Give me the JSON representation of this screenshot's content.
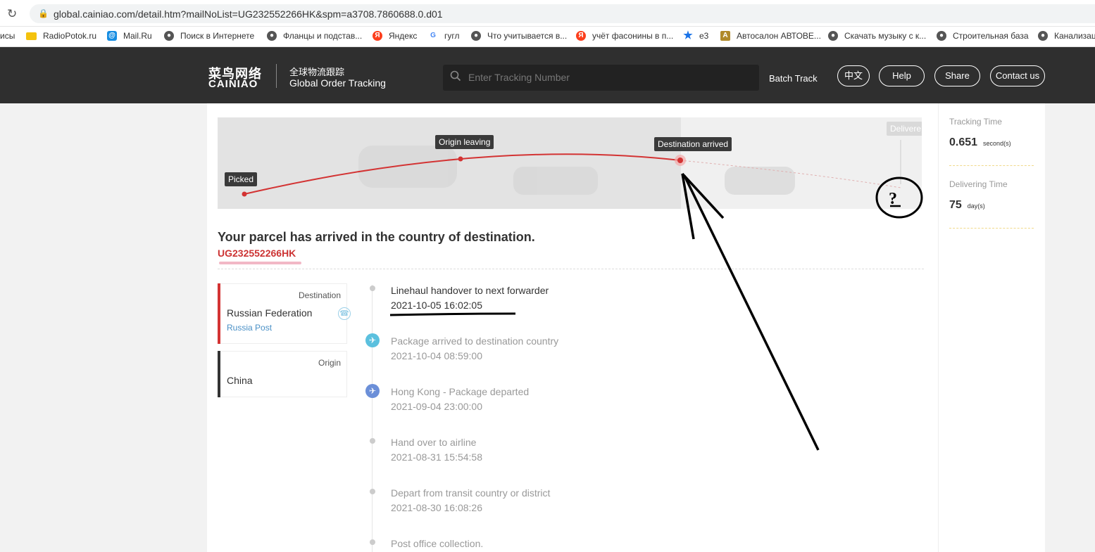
{
  "browser": {
    "url": "global.cainiao.com/detail.htm?mailNoList=UG232552266HK&spm=a3708.7860688.0.d01",
    "bookmarks": [
      {
        "label": "исы",
        "icon": "none"
      },
      {
        "label": "RadioPotok.ru",
        "icon": "tag-icon"
      },
      {
        "label": "Mail.Ru",
        "icon": "mail-icon"
      },
      {
        "label": "Поиск в Интернете",
        "icon": "globe-icon"
      },
      {
        "label": "Фланцы и подстав...",
        "icon": "globe-icon"
      },
      {
        "label": "Яндекс",
        "icon": "yandex-icon"
      },
      {
        "label": "гугл",
        "icon": "google-icon"
      },
      {
        "label": "Что учитывается в...",
        "icon": "globe-icon"
      },
      {
        "label": "учёт фасонины в п...",
        "icon": "yandex-icon"
      },
      {
        "label": "е3",
        "icon": "star-icon"
      },
      {
        "label": "Автосалон АВТОВЕ...",
        "icon": "site-icon"
      },
      {
        "label": "Скачать музыку с к...",
        "icon": "globe-icon"
      },
      {
        "label": "Строительная база",
        "icon": "globe-icon"
      },
      {
        "label": "Канализац",
        "icon": "globe-icon"
      }
    ]
  },
  "header": {
    "logo_cn": "菜鸟网络",
    "logo_en": "CAINIAO",
    "subtitle_cn": "全球物流跟踪",
    "subtitle_en": "Global Order Tracking",
    "search_placeholder": "Enter Tracking Number",
    "batch_track": "Batch Track",
    "buttons": [
      "中文",
      "Help",
      "Share",
      "Contact us"
    ]
  },
  "map": {
    "milestones": [
      "Picked",
      "Origin leaving",
      "Destination arrived",
      "Delivere"
    ],
    "question_mark": "?"
  },
  "status": {
    "headline": "Your parcel has arrived in the country of destination.",
    "tracking_number": "UG232552266HK"
  },
  "destination": {
    "label": "Destination",
    "country": "Russian Federation",
    "carrier": "Russia Post"
  },
  "origin": {
    "label": "Origin",
    "country": "China"
  },
  "events": [
    {
      "title": "Linehaul handover to next forwarder",
      "time": "2021-10-05 16:02:05",
      "icon": "dot"
    },
    {
      "title": "Package arrived to destination country",
      "time": "2021-10-04 08:59:00",
      "icon": "plane-landing-icon"
    },
    {
      "title": "Hong Kong - Package departed",
      "time": "2021-09-04 23:00:00",
      "icon": "plane-departing-icon"
    },
    {
      "title": "Hand over to airline",
      "time": "2021-08-31 15:54:58",
      "icon": "dot"
    },
    {
      "title": "Depart from transit country or district",
      "time": "2021-08-30 16:08:26",
      "icon": "dot"
    },
    {
      "title": "Post office collection.",
      "time": "",
      "icon": "dot"
    }
  ],
  "stats": {
    "tracking_time_label": "Tracking Time",
    "tracking_time_value": "0.651",
    "tracking_time_unit": "second(s)",
    "delivering_time_label": "Delivering Time",
    "delivering_time_value": "75",
    "delivering_time_unit": "day(s)"
  },
  "colors": {
    "header_bg": "#2f2f2f",
    "route_red": "#d33333",
    "destination_bar": "#d33333",
    "origin_bar": "#333333",
    "tracking_number": "#cc3333"
  }
}
